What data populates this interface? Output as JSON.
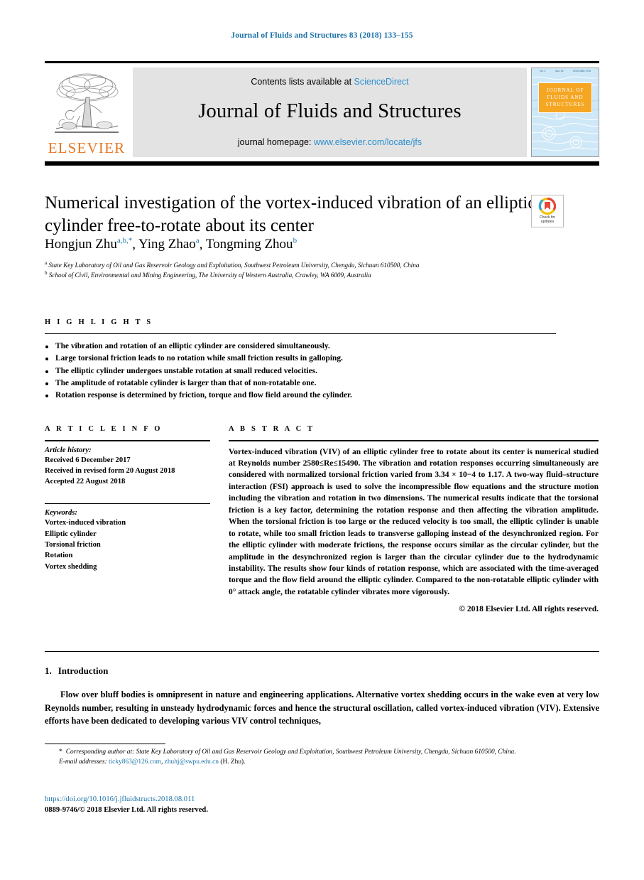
{
  "running_head": "Journal of Fluids and Structures 83 (2018) 133–155",
  "masthead": {
    "contents_prefix": "Contents lists available at ",
    "contents_link": "ScienceDirect",
    "journal_name": "Journal of Fluids and Structures",
    "homepage_prefix": "journal homepage: ",
    "homepage_link": "www.elsevier.com/locate/jfs",
    "publisher": "ELSEVIER",
    "cover": {
      "line1": "JOURNAL OF",
      "line2": "FLUIDS AND",
      "line3": "STRUCTURES",
      "top_left": "Vol. 3",
      "top_mid": "Mar. 18",
      "top_right": "ISSN 0889-9746"
    },
    "colors": {
      "link_blue": "#2b8fd0",
      "elsevier_orange": "#E87722",
      "band_grey": "#e3e3e3",
      "cover_blue": "#cfe8f7",
      "cover_orange": "#F5A623"
    }
  },
  "crossmark": {
    "line1": "Check for",
    "line2": "updates"
  },
  "article": {
    "title": "Numerical investigation of the vortex-induced vibration of an elliptic cylinder free-to-rotate about its center",
    "authors": [
      {
        "name": "Hongjun Zhu",
        "sup": "a,b,*"
      },
      {
        "name": "Ying Zhao",
        "sup": "a"
      },
      {
        "name": "Tongming Zhou",
        "sup": "b"
      }
    ],
    "affiliations": [
      {
        "marker": "a",
        "text": "State Key Laboratory of Oil and Gas Reservoir Geology and Exploitation, Southwest Petroleum University, Chengdu, Sichuan 610500, China"
      },
      {
        "marker": "b",
        "text": "School of Civil, Environmental and Mining Engineering, The University of Western Australia, Crawley, WA 6009, Australia"
      }
    ]
  },
  "highlights": {
    "heading": "H I G H L I G H T S",
    "items": [
      "The vibration and rotation of an elliptic cylinder are considered simultaneously.",
      "Large torsional friction leads to no rotation while small friction results in galloping.",
      "The elliptic cylinder undergoes unstable rotation at small reduced velocities.",
      "The amplitude of rotatable cylinder is larger than that of non-rotatable one.",
      "Rotation response is determined by friction, torque and flow field around the cylinder."
    ]
  },
  "article_info": {
    "heading": "A R T I C L E    I N F O",
    "history_label": "Article history:",
    "history": [
      "Received 6 December 2017",
      "Received in revised form 20 August 2018",
      "Accepted 22 August 2018"
    ],
    "keywords_label": "Keywords:",
    "keywords": [
      "Vortex-induced vibration",
      "Elliptic cylinder",
      "Torsional friction",
      "Rotation",
      "Vortex shedding"
    ]
  },
  "abstract": {
    "heading": "A B S T R A C T",
    "text": "Vortex-induced vibration (VIV) of an elliptic cylinder free to rotate about its center is numerical studied at Reynolds number 2580≤Re≤15490. The vibration and rotation responses occurring simultaneously are considered with normalized torsional friction varied from 3.34 × 10−4 to 1.17. A two-way fluid–structure interaction (FSI) approach is used to solve the incompressible flow equations and the structure motion including the vibration and rotation in two dimensions. The numerical results indicate that the torsional friction is a key factor, determining the rotation response and then affecting the vibration amplitude. When the torsional friction is too large or the reduced velocity is too small, the elliptic cylinder is unable to rotate, while too small friction leads to transverse galloping instead of the desynchronized region. For the elliptic cylinder with moderate frictions, the response occurs similar as the circular cylinder, but the amplitude in the desynchronized region is larger than the circular cylinder due to the hydrodynamic instability. The results show four kinds of rotation response, which are associated with the time-averaged torque and the flow field around the elliptic cylinder. Compared to the non-rotatable elliptic cylinder with 0° attack angle, the rotatable cylinder vibrates more vigorously.",
    "copyright": "© 2018 Elsevier Ltd. All rights reserved."
  },
  "introduction": {
    "number": "1.",
    "heading": "Introduction",
    "paragraph": "Flow over bluff bodies is omnipresent in nature and engineering applications. Alternative vortex shedding occurs in the wake even at very low Reynolds number, resulting in unsteady hydrodynamic forces and hence the structural oscillation, called vortex-induced vibration (VIV). Extensive efforts have been dedicated to developing various  VIV control techniques,"
  },
  "footnote": {
    "star": "*",
    "corresponding": "Corresponding author at: State Key Laboratory of Oil and Gas Reservoir Geology and Exploitation, Southwest Petroleum University, Chengdu, Sichuan 610500, China.",
    "email_label": "E-mail addresses:",
    "email1": "ticky863@126.com",
    "email_sep": ", ",
    "email2": "zhuhj@swpu.edu.cn",
    "email_suffix": " (H. Zhu).",
    "doi": "https://doi.org/10.1016/j.jfluidstructs.2018.08.011",
    "issn": "0889-9746/© 2018 Elsevier Ltd. All rights reserved."
  }
}
